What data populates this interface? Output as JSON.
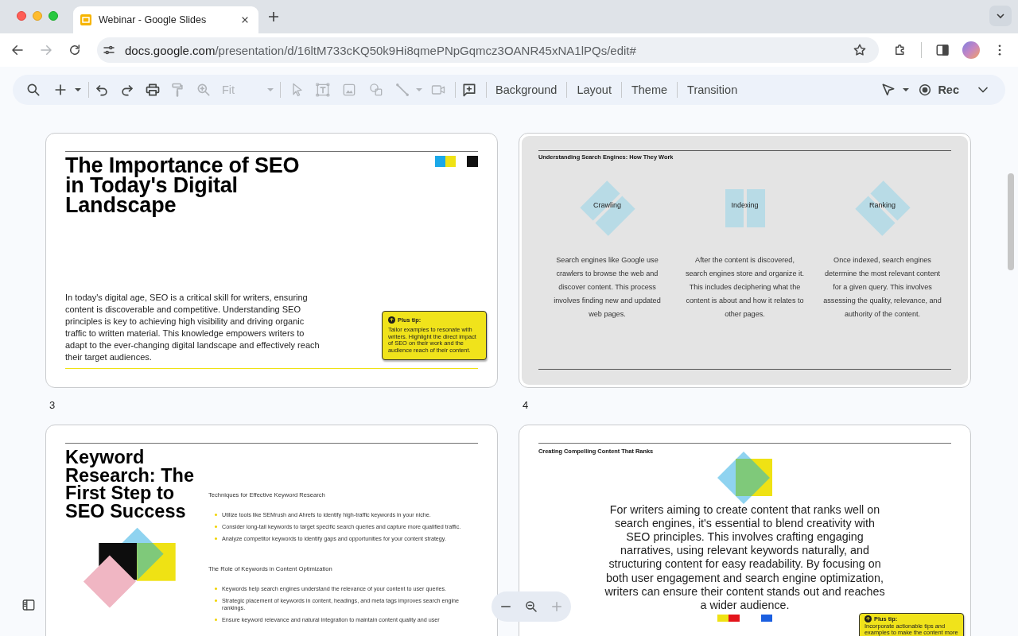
{
  "browser": {
    "tabs": [
      {
        "title": "Webinar - Google Slides",
        "selected": true
      }
    ],
    "navigation": [
      {
        "disabled": false
      },
      {
        "disabled": true
      },
      {
        "disabled": false
      }
    ],
    "url": {
      "host": "docs.google.com",
      "path": "/presentation/d/16ltM733cKQ50k9Hi8qmePNpGqmcz3OANR45xNA1lPQs/edit#"
    },
    "bookmarked": false
  },
  "toolbar": {
    "tools": [
      {
        "disabled": false
      },
      {
        "disabled": false
      },
      {
        "disabled": false
      },
      {
        "disabled": false
      },
      {
        "disabled": false
      },
      {
        "disabled": true
      },
      {
        "disabled": true
      },
      {
        "disabled": true
      },
      {
        "disabled": true
      },
      {
        "disabled": true
      },
      {
        "disabled": true
      },
      {
        "disabled": true
      },
      {
        "disabled": true
      },
      {
        "disabled": false
      }
    ],
    "zoom": {
      "value": "Fit",
      "disabled": true
    },
    "menu_buttons": [
      "Background",
      "Layout",
      "Theme",
      "Transition"
    ],
    "record": {
      "label": "Rec"
    }
  },
  "slides": [
    {
      "kind": "title",
      "title": "The Importance of SEO in Today's Digital Landscape",
      "body": "In today's digital age, SEO is a critical skill for writers, ensuring content is discoverable and competitive. Understanding SEO principles is key to achieving high visibility and driving organic traffic to written material. This knowledge empowers writers to adapt to the ever-changing digital landscape and effectively reach their target audiences.",
      "tip": {
        "label": "Plus tip:",
        "text": "Tailor examples to resonate with writers. Highlight the direct impact of SEO on their work and the audience reach of their content."
      }
    },
    {
      "kind": "steps",
      "heading": "Understanding Search Engines: How They Work",
      "steps": [
        {
          "label": "Crawling",
          "text": "Search engines like Google use crawlers to browse the web and discover content. This process involves finding new and updated web pages."
        },
        {
          "label": "Indexing",
          "text": "After the content is discovered, search engines store and organize it. This includes deciphering what the content is about and how it relates to other pages."
        },
        {
          "label": "Ranking",
          "text": "Once indexed, search engines determine the most relevant content for a given query. This involves assessing the quality, relevance, and authority of the content."
        }
      ]
    },
    {
      "kind": "sections",
      "number": "3",
      "title": "Keyword Research: The First Step to SEO Success",
      "sections": [
        {
          "heading": "Techniques for Effective Keyword Research",
          "bullets": [
            "Utilize tools like SEMrush and Ahrefs to identify high-traffic keywords in your niche.",
            "Consider long-tail keywords to target specific search queries and capture more qualified traffic.",
            "Analyze competitor keywords to identify gaps and opportunities for your content strategy."
          ]
        },
        {
          "heading": "The Role of Keywords in Content Optimization",
          "bullets": [
            "Keywords help search engines understand the relevance of your content to user queries.",
            "Strategic placement of keywords in content, headings, and meta tags improves search engine rankings.",
            "Ensure keyword relevance and natural integration to maintain content quality and user"
          ]
        }
      ]
    },
    {
      "kind": "statement",
      "number": "4",
      "heading": "Creating Compelling Content That Ranks",
      "body": "For writers aiming to create content that ranks well on search engines, it's essential to blend creativity with SEO principles. This involves crafting engaging narratives, using relevant keywords naturally, and structuring content for easy readability. By focusing on both user engagement and search engine optimization, writers can ensure their content stands out and reaches a wider audience.",
      "tip": {
        "label": "Plus tip:",
        "text": "Incorporate actionable tips and examples to make the content more"
      }
    }
  ],
  "zoom_controls": [
    {
      "disabled": false
    },
    {
      "disabled": false
    },
    {
      "disabled": true
    }
  ]
}
